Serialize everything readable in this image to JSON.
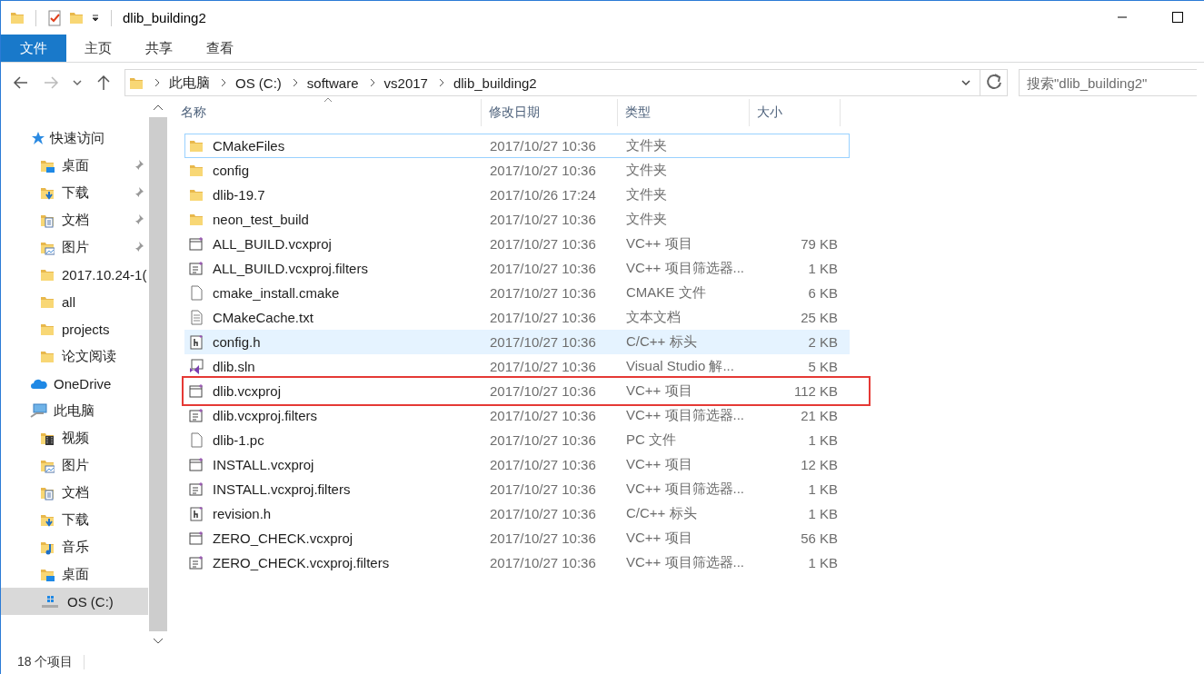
{
  "window": {
    "title": "dlib_building2"
  },
  "ribbon_tabs": [
    {
      "label": "文件",
      "selected": true
    },
    {
      "label": "主页",
      "selected": false
    },
    {
      "label": "共享",
      "selected": false
    },
    {
      "label": "查看",
      "selected": false
    }
  ],
  "address_bar": {
    "segments": [
      "此电脑",
      "OS (C:)",
      "software",
      "vs2017",
      "dlib_building2"
    ]
  },
  "search": {
    "placeholder": "搜索\"dlib_building2\""
  },
  "sidebar": {
    "items": [
      {
        "label": "快速访问",
        "kind": "star",
        "selected": false,
        "children": [
          {
            "label": "桌面",
            "kind": "desktop",
            "pinned": true,
            "selected": false
          },
          {
            "label": "下载",
            "kind": "download",
            "pinned": true,
            "selected": false
          },
          {
            "label": "文档",
            "kind": "docs",
            "pinned": true,
            "selected": false
          },
          {
            "label": "图片",
            "kind": "pictures",
            "pinned": true,
            "selected": false
          },
          {
            "label": "2017.10.24-1(",
            "kind": "folder",
            "pinned": false,
            "selected": false
          },
          {
            "label": "all",
            "kind": "folder",
            "pinned": false,
            "selected": false
          },
          {
            "label": "projects",
            "kind": "folder",
            "pinned": false,
            "selected": false
          },
          {
            "label": "论文阅读",
            "kind": "folder",
            "pinned": false,
            "selected": false
          }
        ]
      },
      {
        "label": "OneDrive",
        "kind": "cloud",
        "selected": false
      },
      {
        "label": "此电脑",
        "kind": "pc",
        "selected": false,
        "children": [
          {
            "label": "视频",
            "kind": "video",
            "pinned": false,
            "selected": false
          },
          {
            "label": "图片",
            "kind": "pictures",
            "pinned": false,
            "selected": false
          },
          {
            "label": "文档",
            "kind": "docs",
            "pinned": false,
            "selected": false
          },
          {
            "label": "下载",
            "kind": "download",
            "pinned": false,
            "selected": false
          },
          {
            "label": "音乐",
            "kind": "music",
            "pinned": false,
            "selected": false
          },
          {
            "label": "桌面",
            "kind": "desktop",
            "pinned": false,
            "selected": false
          },
          {
            "label": "OS (C:)",
            "kind": "drive",
            "pinned": false,
            "selected": true
          }
        ]
      }
    ]
  },
  "table": {
    "columns": [
      "名称",
      "修改日期",
      "类型",
      "大小"
    ],
    "rows": [
      {
        "name": "CMakeFiles",
        "date": "2017/10/27 10:36",
        "type": "文件夹",
        "kind": "folder",
        "focused": true,
        "hovered": false,
        "highlighted": false
      },
      {
        "name": "config",
        "date": "2017/10/27 10:36",
        "type": "文件夹",
        "kind": "folder",
        "focused": false,
        "hovered": false,
        "highlighted": false
      },
      {
        "name": "dlib-19.7",
        "date": "2017/10/26 17:24",
        "type": "文件夹",
        "kind": "folder",
        "focused": false,
        "hovered": false,
        "highlighted": false
      },
      {
        "name": "neon_test_build",
        "date": "2017/10/27 10:36",
        "type": "文件夹",
        "kind": "folder",
        "focused": false,
        "hovered": false,
        "highlighted": false
      },
      {
        "name": "ALL_BUILD.vcxproj",
        "date": "2017/10/27 10:36",
        "type": "VC++ 项目",
        "size": "79 KB",
        "kind": "project",
        "focused": false,
        "hovered": false,
        "highlighted": false
      },
      {
        "name": "ALL_BUILD.vcxproj.filters",
        "date": "2017/10/27 10:36",
        "type": "VC++ 项目筛选器...",
        "size": "1 KB",
        "kind": "filters",
        "focused": false,
        "hovered": false,
        "highlighted": false
      },
      {
        "name": "cmake_install.cmake",
        "date": "2017/10/27 10:36",
        "type": "CMAKE 文件",
        "size": "6 KB",
        "kind": "blank",
        "focused": false,
        "hovered": false,
        "highlighted": false
      },
      {
        "name": "CMakeCache.txt",
        "date": "2017/10/27 10:36",
        "type": "文本文档",
        "size": "25 KB",
        "kind": "text",
        "focused": false,
        "hovered": false,
        "highlighted": false
      },
      {
        "name": "config.h",
        "date": "2017/10/27 10:36",
        "type": "C/C++ 标头",
        "size": "2 KB",
        "kind": "header",
        "focused": false,
        "hovered": true,
        "highlighted": false
      },
      {
        "name": "dlib.sln",
        "date": "2017/10/27 10:36",
        "type": "Visual Studio 解...",
        "size": "5 KB",
        "kind": "solution",
        "focused": false,
        "hovered": false,
        "highlighted": false
      },
      {
        "name": "dlib.vcxproj",
        "date": "2017/10/27 10:36",
        "type": "VC++ 项目",
        "size": "112 KB",
        "kind": "project",
        "focused": false,
        "hovered": false,
        "highlighted": true
      },
      {
        "name": "dlib.vcxproj.filters",
        "date": "2017/10/27 10:36",
        "type": "VC++ 项目筛选器...",
        "size": "21 KB",
        "kind": "filters",
        "focused": false,
        "hovered": false,
        "highlighted": false
      },
      {
        "name": "dlib-1.pc",
        "date": "2017/10/27 10:36",
        "type": "PC 文件",
        "size": "1 KB",
        "kind": "blank",
        "focused": false,
        "hovered": false,
        "highlighted": false
      },
      {
        "name": "INSTALL.vcxproj",
        "date": "2017/10/27 10:36",
        "type": "VC++ 项目",
        "size": "12 KB",
        "kind": "project",
        "focused": false,
        "hovered": false,
        "highlighted": false
      },
      {
        "name": "INSTALL.vcxproj.filters",
        "date": "2017/10/27 10:36",
        "type": "VC++ 项目筛选器...",
        "size": "1 KB",
        "kind": "filters",
        "focused": false,
        "hovered": false,
        "highlighted": false
      },
      {
        "name": "revision.h",
        "date": "2017/10/27 10:36",
        "type": "C/C++ 标头",
        "size": "1 KB",
        "kind": "header",
        "focused": false,
        "hovered": false,
        "highlighted": false
      },
      {
        "name": "ZERO_CHECK.vcxproj",
        "date": "2017/10/27 10:36",
        "type": "VC++ 项目",
        "size": "56 KB",
        "kind": "project",
        "focused": false,
        "hovered": false,
        "highlighted": false
      },
      {
        "name": "ZERO_CHECK.vcxproj.filters",
        "date": "2017/10/27 10:36",
        "type": "VC++ 项目筛选器...",
        "size": "1 KB",
        "kind": "filters",
        "focused": false,
        "hovered": false,
        "highlighted": false
      }
    ]
  },
  "status_bar": {
    "item_count": "18 个项目"
  }
}
